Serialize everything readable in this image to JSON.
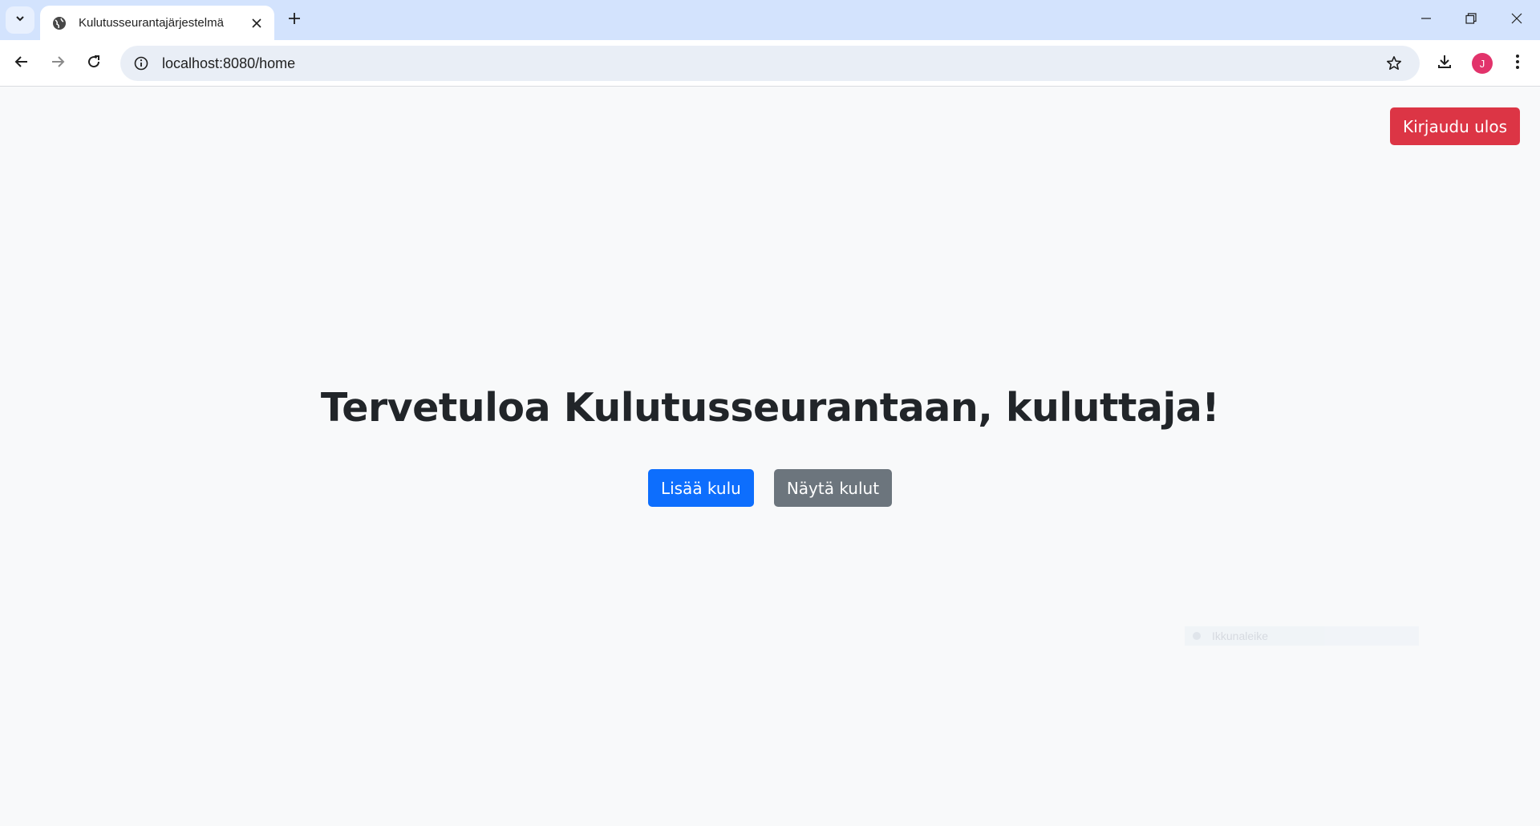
{
  "browser": {
    "tab_title": "Kulutusseurantajärjestelmä",
    "url": "localhost:8080/home",
    "avatar_letter": "J"
  },
  "page": {
    "logout_label": "Kirjaudu ulos",
    "welcome_title": "Tervetuloa Kulutusseurantaan, kuluttaja!",
    "add_expense_label": "Lisää kulu",
    "show_expenses_label": "Näytä kulut",
    "ghost_tooltip": "Ikkunaleike"
  },
  "colors": {
    "danger": "#dc3545",
    "primary": "#0d6efd",
    "secondary": "#6c757d",
    "avatar": "#e2336b"
  }
}
